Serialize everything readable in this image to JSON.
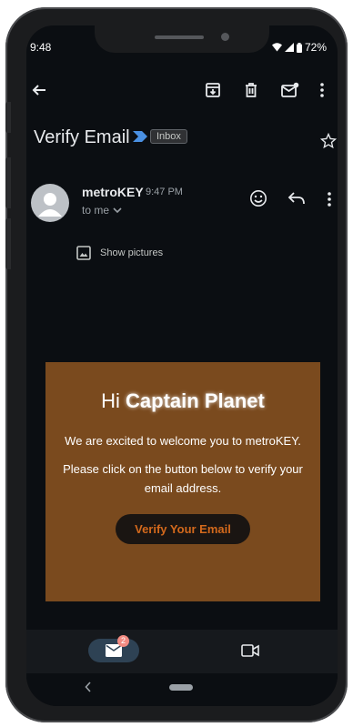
{
  "status": {
    "time": "9:48",
    "battery": "72%"
  },
  "toolbar": {
    "back_icon": "arrow-back-icon",
    "archive_icon": "archive-icon",
    "delete_icon": "trash-icon",
    "unread_icon": "mark-unread-icon",
    "more_icon": "more-vert-icon"
  },
  "email": {
    "subject": "Verify Email",
    "label": "Inbox",
    "sender": "metroKEY",
    "time": "9:47 PM",
    "recipient": "to me",
    "show_pictures": "Show pictures"
  },
  "card": {
    "greeting": "Hi",
    "name": "Captain Planet",
    "line1": "We are excited to welcome you to metroKEY.",
    "line2": "Please click on the button below to verify your email address.",
    "button": "Verify Your Email"
  },
  "bottom_nav": {
    "mail_badge": "2"
  },
  "colors": {
    "background": "#0b0e12",
    "card": "#7a4a1e",
    "button_text": "#d3691c",
    "accent_blue": "#4a90e2"
  }
}
